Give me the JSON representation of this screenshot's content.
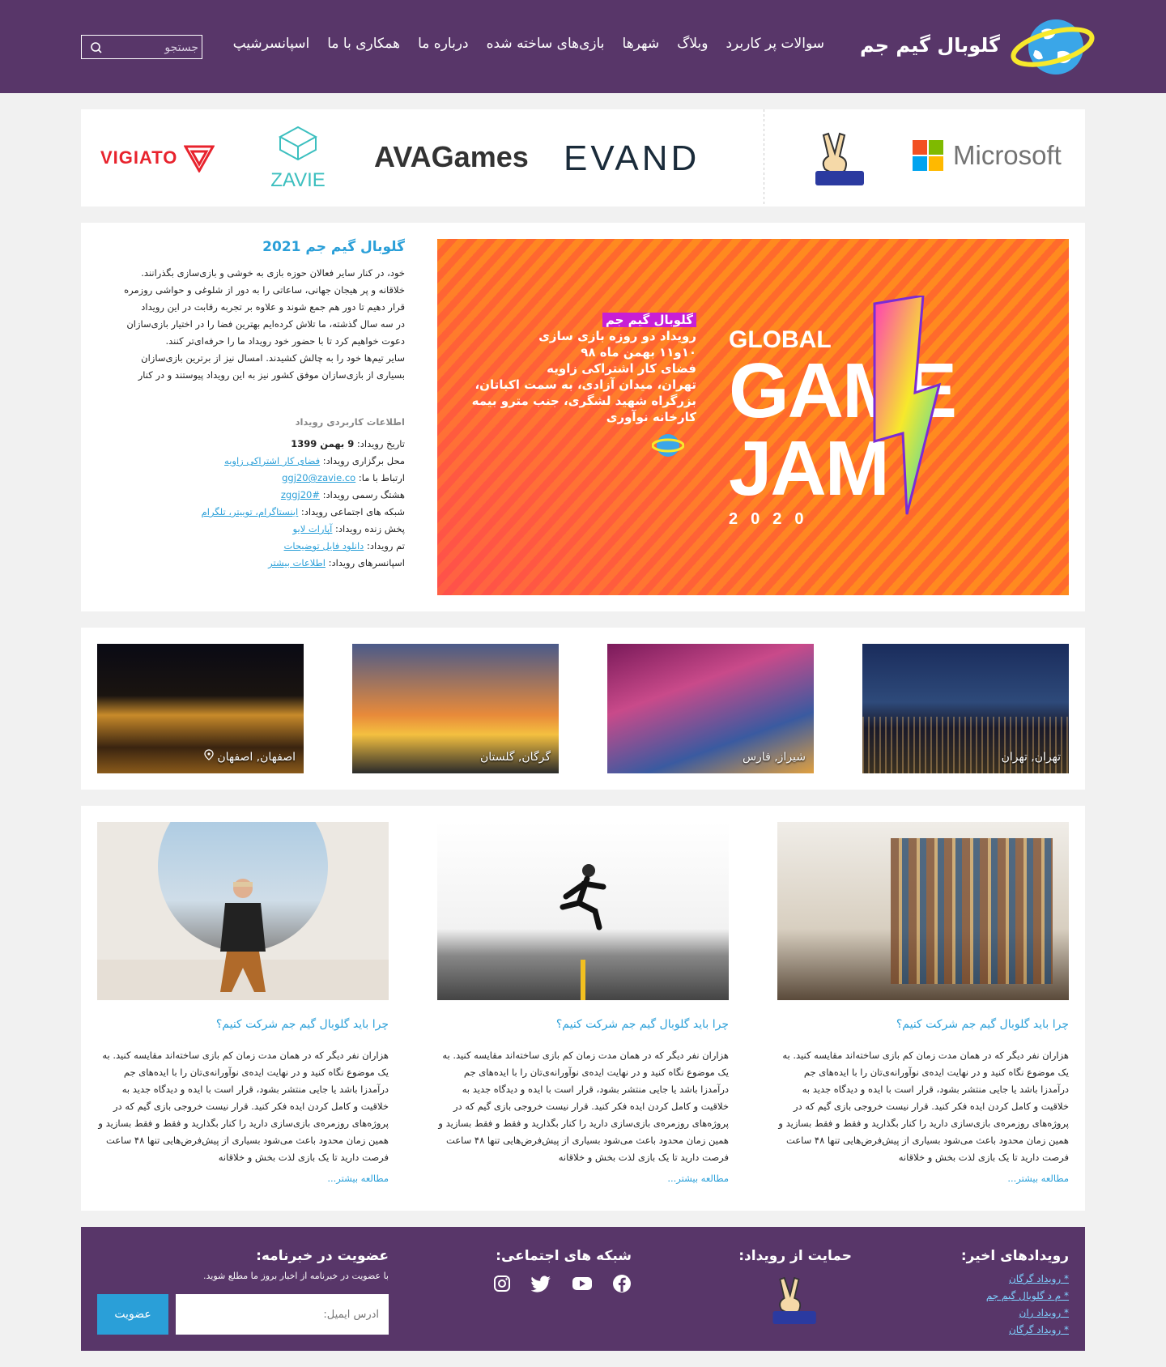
{
  "header": {
    "site_title": "گلوبال گیم جم",
    "nav": [
      "سوالات پر کاربرد",
      "وبلاگ",
      "شهرها",
      "بازی‌های ساخته شده",
      "درباره ما",
      "همکاری با ما",
      "اسپانسرشیپ"
    ],
    "search_placeholder": "جستجو"
  },
  "sponsors": [
    "Microsoft",
    "EVAND",
    "AVAGames",
    "ZAVIE",
    "VIGIATO"
  ],
  "colors": {
    "header_bg": "#583669",
    "accent": "#2a9fd8",
    "poster_orange": "#ff7a22"
  },
  "event": {
    "title": "گلوبال گیم جم 2021",
    "description": [
      "خود، در کنار سایر فعالان حوزه بازی به خوشی و بازی‌سازی بگذرانند.",
      "خلاقانه و پر هیجان جهانی، ساعاتی را به دور از شلوغی و حواشی روزمره",
      "قرار دهیم تا دور هم جمع شوند و علاوه بر تجربه رقابت در این رویداد",
      "در سه سال گذشته، ما تلاش کرده‌ایم بهترین فضا را در اختیار بازی‌سازان",
      "دعوت خواهیم کرد تا با حضور خود رویداد ما را حرفه‌ای‌تر کنند.",
      "سایر تیم‌ها خود را به چالش کشیدند. امسال نیز از برترین بازی‌سازان",
      "بسیاری از بازی‌سازان موفق کشور نیز به این رویداد پیوستند و در کنار"
    ],
    "info_heading": "اطلاعات کاربردی رویداد",
    "info": [
      {
        "label": "تاریخ رویداد: ",
        "value": "9 بهمن 1399",
        "link": false
      },
      {
        "label": "محل برگزاری رویداد: ",
        "value": "فضای کار اشتراکی زاویه",
        "link": true
      },
      {
        "label": "ارتباط با ما: ",
        "value": "ggj20@zavie.co",
        "link": true
      },
      {
        "label": "هشتگ رسمی رویداد: ",
        "value": "#zggj20",
        "link": true
      },
      {
        "label": "شبکه های اجتماعی رویداد: ",
        "value": "اینستاگرام، توییتر، تلگرام",
        "link": true
      },
      {
        "label": "پخش زنده رویداد: ",
        "value": "آپارات لایو",
        "link": true
      },
      {
        "label": "تم رویداد: ",
        "value": "دانلود فایل توضیحات",
        "link": true
      },
      {
        "label": "اسپانسرهای رویداد: ",
        "value": "اطلاعات بیشتر",
        "link": true
      }
    ],
    "poster": {
      "lines": [
        "گلوبال گیم جم",
        "رویداد دو روزه بازی سازی",
        "۱۰و۱۱ بهمن ماه ۹۸",
        "فضای کار اشتراکی زاویه",
        "تهران، میدان آزادی، به سمت اکباتان،",
        "بزرگراه شهید لشگری، جنب مترو بیمه",
        "کارخانه نوآوری"
      ],
      "big_1": "GLOBAL",
      "big_2": "GAME",
      "big_3": "JAM",
      "year": "2020"
    }
  },
  "cities": [
    "تهران, تهران",
    "شیراز, فارس",
    "گرگان, گلستان",
    "اصفهان, اصفهان"
  ],
  "articles": [
    {
      "title": "چرا باید گلوبال گیم جم شرکت کنیم؟",
      "body": "هزاران نفر دیگر که در همان مدت زمان کم بازی ساخته‌اند مقایسه کنید. به یک موضوع نگاه کنید و در نهایت ایده‌ی نوآورانه‌ی‌تان را با ایده‌های جم درآمدزا باشد یا جایی منتشر بشود، قرار است با ایده و دیدگاه جدید به خلاقیت و کامل کردن ایده فکر کنید. قرار نیست خروجی بازی گیم که در پروژه‌های روزمره‌ی بازی‌سازی دارید را کنار بگذارید و فقط و فقط بسازید و همین زمان محدود باعث می‌شود بسیاری از پیش‌فرض‌هایی تنها ۴۸ ساعت فرصت دارید تا یک بازی لذت بخش و خلاقانه",
      "more": "مطالعه بیشتر..."
    },
    {
      "title": "چرا باید گلوبال گیم جم شرکت کنیم؟",
      "body": "هزاران نفر دیگر که در همان مدت زمان کم بازی ساخته‌اند مقایسه کنید. به یک موضوع نگاه کنید و در نهایت ایده‌ی نوآورانه‌ی‌تان را با ایده‌های جم درآمدزا باشد یا جایی منتشر بشود، قرار است با ایده و دیدگاه جدید به خلاقیت و کامل کردن ایده فکر کنید. قرار نیست خروجی بازی گیم که در پروژه‌های روزمره‌ی بازی‌سازی دارید را کنار بگذارید و فقط و فقط بسازید و همین زمان محدود باعث می‌شود بسیاری از پیش‌فرض‌هایی تنها ۴۸ ساعت فرصت دارید تا یک بازی لذت بخش و خلاقانه",
      "more": "مطالعه بیشتر..."
    },
    {
      "title": "چرا باید گلوبال گیم جم شرکت کنیم؟",
      "body": "هزاران نفر دیگر که در همان مدت زمان کم بازی ساخته‌اند مقایسه کنید. به یک موضوع نگاه کنید و در نهایت ایده‌ی نوآورانه‌ی‌تان را با ایده‌های جم درآمدزا باشد یا جایی منتشر بشود، قرار است با ایده و دیدگاه جدید به خلاقیت و کامل کردن ایده فکر کنید. قرار نیست خروجی بازی گیم که در پروژه‌های روزمره‌ی بازی‌سازی دارید را کنار بگذارید و فقط و فقط بسازید و همین زمان محدود باعث می‌شود بسیاری از پیش‌فرض‌هایی تنها ۴۸ ساعت فرصت دارید تا یک بازی لذت بخش و خلاقانه",
      "more": "مطالعه بیشتر..."
    }
  ],
  "footer": {
    "recent_events_title": "رویدادهای اخیر:",
    "recent_events": [
      "* رویداد گرگان",
      "* م د گلوبال گیم جم",
      "* رویداد ران",
      "* رویداد گرگان"
    ],
    "support_title": "حمایت از رویداد:",
    "social_title": "شبکه های اجتماعی:",
    "social_icons": [
      "facebook-icon",
      "youtube-icon",
      "twitter-icon",
      "instagram-icon"
    ],
    "newsletter_title": "عضویت در خبرنامه:",
    "newsletter_desc": "با عضویت در خبرنامه از اخبار بروز ما مطلع شوید.",
    "email_placeholder": "آدرس ایمیل:",
    "subscribe_label": "عضویت"
  }
}
